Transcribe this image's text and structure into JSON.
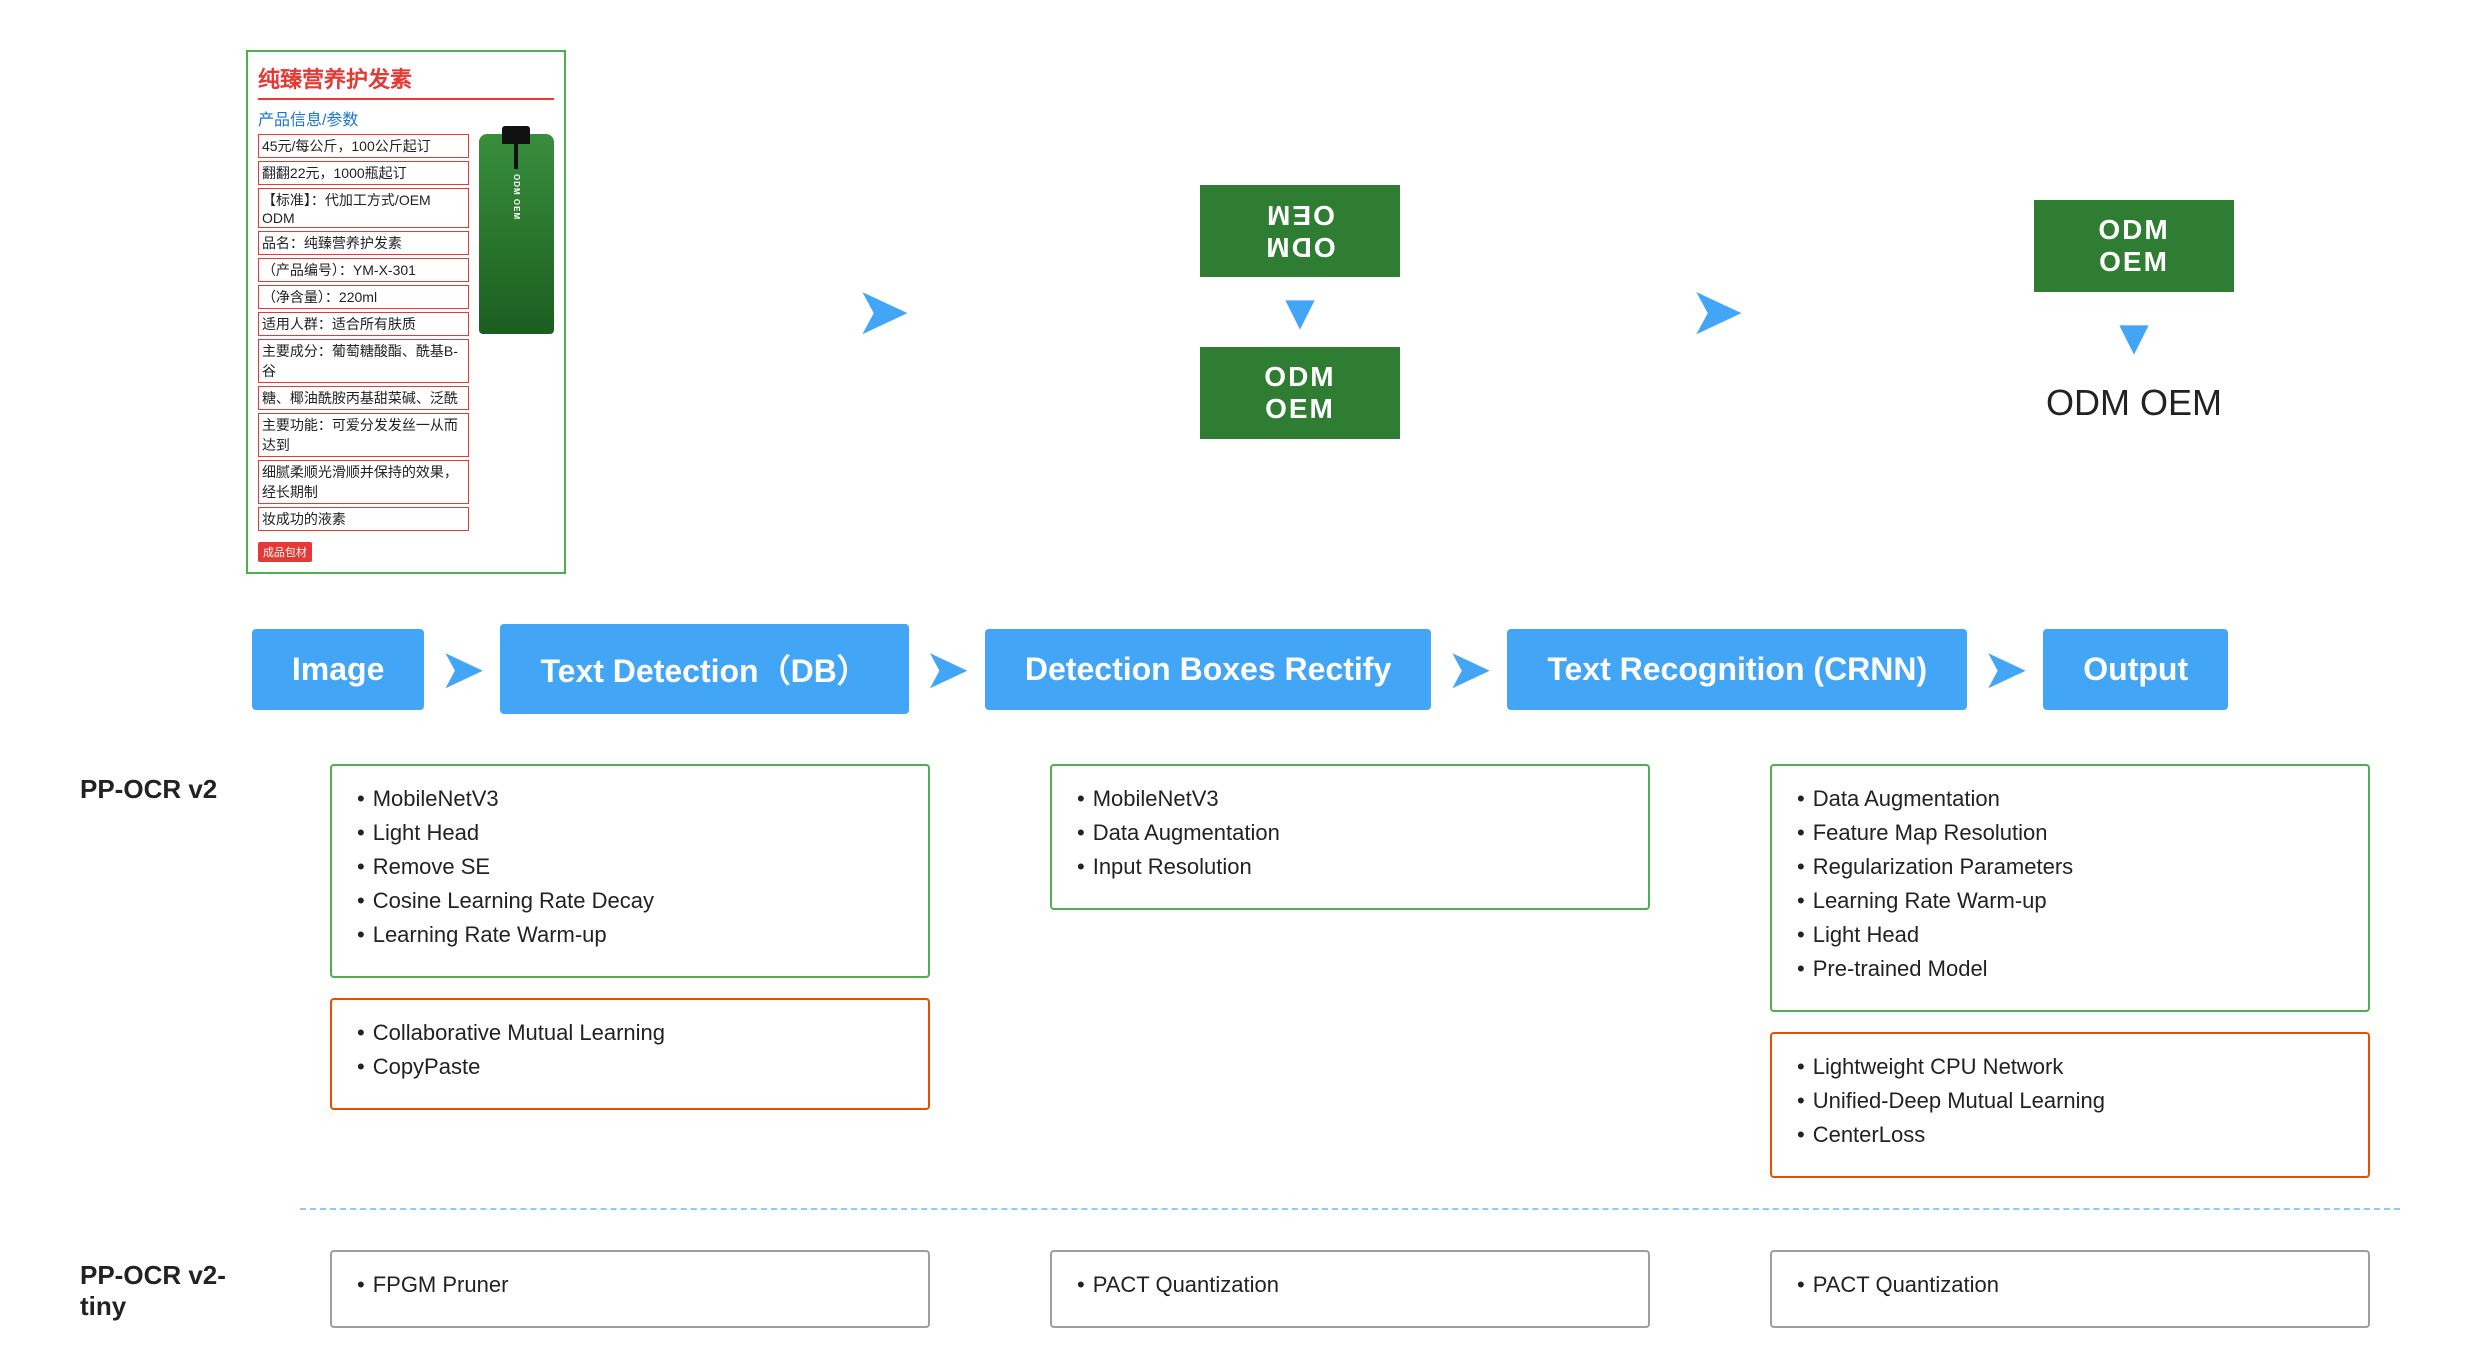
{
  "top": {
    "image_title": "纯臻营养护发素",
    "image_subtitle": "产品信息/参数",
    "image_lines": [
      "45元/每公斤，100公斤起订",
      "翻翻22元，1000瓶起订",
      "【标准】：代加工方式/OEM ODM",
      "品名：纯臻营养护发素",
      "（产品编号）：YM-X-301",
      "（净含量）：220ml",
      "适用人群：适合所有肤质",
      "主要成分：葡萄糖酸酯、酰基B-谷",
      "糖、椰油酰胺丙基甜菜碱、泛酰",
      "主要功能：可爱分发发丝一从而达到",
      "细腻柔顺光滑顺并保持的效果，经长期制",
      "妆成功的液素"
    ],
    "bottle_label": "ODM OEM",
    "bottom_tag": "成品包材",
    "odm_flipped_text": "MƎO WƎO",
    "odm_normal_text": "ODM OEM",
    "odm_right_top": "ODM OEM",
    "odm_right_plain": "ODM OEM"
  },
  "flow": {
    "image_label": "Image",
    "text_detection_label": "Text Detection（DB）",
    "detection_boxes_label": "Detection Boxes Rectify",
    "text_recognition_label": "Text Recognition (CRNN)",
    "output_label": "Output"
  },
  "ppocr2": {
    "label": "PP-OCR v2",
    "detection_green": {
      "items": [
        "MobileNetV3",
        "Light Head",
        "Remove SE",
        "Cosine Learning Rate Decay",
        "Learning Rate Warm-up"
      ]
    },
    "detection_orange": {
      "items": [
        "Collaborative Mutual Learning",
        "CopyPaste"
      ]
    },
    "rectify_green": {
      "items": [
        "MobileNetV3",
        "Data Augmentation",
        "Input Resolution"
      ]
    },
    "recognition_green": {
      "items": [
        "Data Augmentation",
        "Feature Map Resolution",
        "Regularization Parameters",
        "Learning Rate Warm-up",
        "Light Head",
        "Pre-trained Model"
      ]
    },
    "recognition_orange": {
      "items": [
        "Lightweight CPU Network",
        "Unified-Deep Mutual Learning",
        "CenterLoss"
      ]
    }
  },
  "ppocr2tiny": {
    "label": "PP-OCR v2-\ntiny",
    "detection_gray": {
      "items": [
        "FPGM Pruner"
      ]
    },
    "rectify_gray": {
      "items": [
        "PACT Quantization"
      ]
    },
    "recognition_gray": {
      "items": [
        "PACT Quantization"
      ]
    }
  }
}
